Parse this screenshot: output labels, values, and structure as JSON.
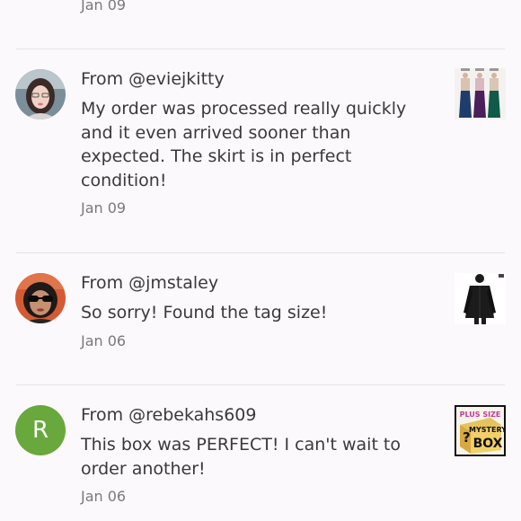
{
  "top_date": "Jan 09",
  "reviews": [
    {
      "from": "From @eviejkitty",
      "message": "My order was processed really quickly and it even arrived sooner than expected. The skirt is in perfect condition!",
      "date": "Jan 09",
      "avatar_icon": "user-photo-icon",
      "thumbnail": "skirts-listing-thumbnail"
    },
    {
      "from": "From @jmstaley",
      "message": "So sorry! Found the tag size!",
      "date": "Jan 06",
      "avatar_icon": "user-photo-icon",
      "thumbnail": "jacket-listing-thumbnail"
    },
    {
      "from": "From @rebekahs609",
      "message": "This box was PERFECT! I can't wait to order another!",
      "date": "Jan 06",
      "avatar_letter": "R",
      "avatar_color": "#68a83c",
      "thumbnail": "mystery-box-thumbnail",
      "thumbnail_text": {
        "top": "PLUS SIZE",
        "middle": "MYSTERY",
        "bottom": "BOX",
        "mark": "?"
      }
    }
  ]
}
